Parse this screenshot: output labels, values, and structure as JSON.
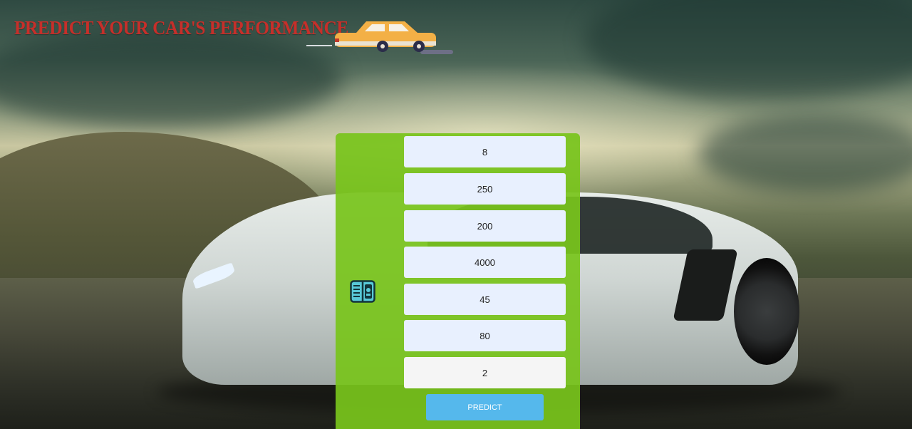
{
  "header": {
    "title": "PREDICT YOUR CAR'S PERFORMANCE",
    "logo_icon": "car-logo-icon"
  },
  "background": {
    "description_icon": "sports-car-background-image"
  },
  "form": {
    "side_icon": "document-form-icon",
    "fields": [
      {
        "value": "8"
      },
      {
        "value": "250"
      },
      {
        "value": "200"
      },
      {
        "value": "4000"
      },
      {
        "value": "45"
      },
      {
        "value": "80"
      },
      {
        "value": "2"
      }
    ],
    "submit_label": "PREDICT"
  },
  "colors": {
    "title": "#c62f2a",
    "panel": "#78c41c",
    "button": "#55b8ec",
    "field_autofill": "#e8f0fe"
  }
}
